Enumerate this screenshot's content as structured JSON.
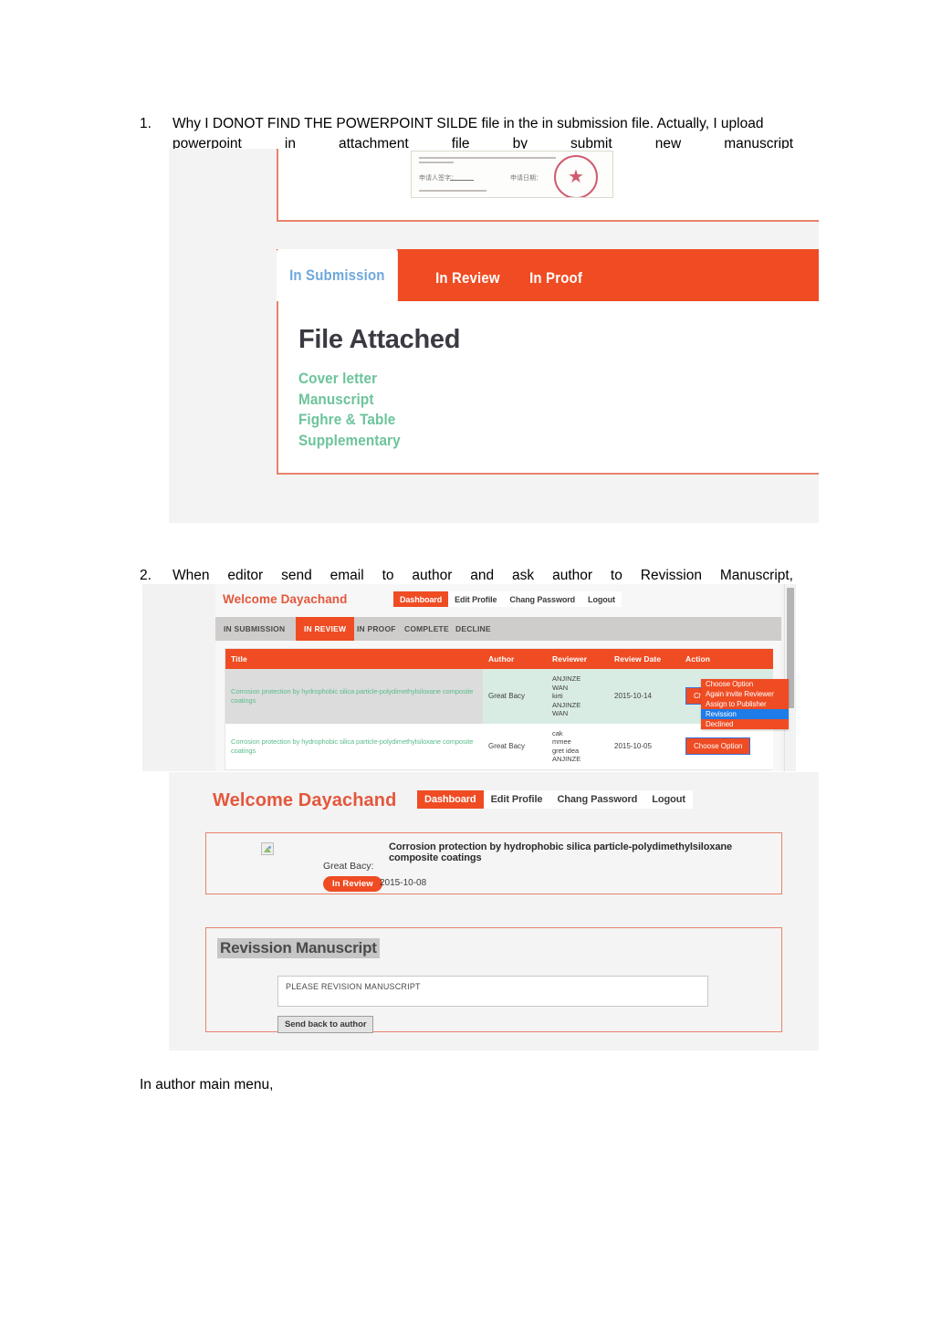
{
  "document": {
    "items": [
      {
        "number": "1.",
        "line1": "Why I DONOT FIND THE POWERPOINT SILDE  file in the in submission file. Actually, I upload",
        "line2": "powerpoint in attachment file by submit new manuscript"
      },
      {
        "number": "2.",
        "line1": "When editor send email to author and ask author to Revission Manuscript,"
      }
    ],
    "closing_text": "In author main menu,"
  },
  "shot1": {
    "scan": {
      "seal_icon": "red-official-seal-star",
      "sig_label": "申请人签字：",
      "date_label": "申请日期："
    },
    "tabs": [
      {
        "label": "In Submission",
        "active": true
      },
      {
        "label": "In Review",
        "active": false
      },
      {
        "label": "In Proof",
        "active": false
      }
    ],
    "heading": "File Attached",
    "links": [
      "Cover letter",
      "Manuscript",
      "Fighre & Table",
      "Supplementary"
    ],
    "colors": {
      "tab_bar": "#ef4c23",
      "active_tab_text": "#6ea8dc",
      "link_green": "#6cc49a",
      "panel_border": "#e8826a"
    }
  },
  "shot2": {
    "welcome": "Welcome Dayachand",
    "nav": [
      {
        "label": "Dashboard",
        "active": true
      },
      {
        "label": "Edit Profile",
        "active": false
      },
      {
        "label": "Chang Password",
        "active": false
      },
      {
        "label": "Logout",
        "active": false
      }
    ],
    "tabs": [
      {
        "label": "IN SUBMISSION",
        "active": false
      },
      {
        "label": "IN REVIEW",
        "active": true
      },
      {
        "label": "IN PROOF",
        "active": false
      },
      {
        "label": "COMPLETE",
        "active": false
      },
      {
        "label": "DECLINE",
        "active": false
      }
    ],
    "table": {
      "headers": [
        "Title",
        "Author",
        "Reviewer",
        "Review Date",
        "Action"
      ],
      "rows": [
        {
          "title": "Corrosion protection by hydrophobic silica particle-polydimethylsiloxane composite coatings",
          "author": "Great Bacy",
          "reviewers": "ANJINZE\nWAN\nkirti\nANJINZE\nWAN",
          "review_date": "2015-10-14",
          "action_label": "Choose Option"
        },
        {
          "title": "Corrosion protection by hydrophobic silica particle-polydimethylsiloxane composite coatings",
          "author": "Great Bacy",
          "reviewers": "cak\nmmee\ngret idea\nANJINZE",
          "review_date": "2015-10-05",
          "action_label": "Choose Option"
        }
      ]
    },
    "dropdown": {
      "open": true,
      "options": [
        {
          "label": "Choose Option",
          "selected": false
        },
        {
          "label": "Again invite Reviewer",
          "selected": false
        },
        {
          "label": "Assign to Publisher",
          "selected": false
        },
        {
          "label": "Revission",
          "selected": true
        },
        {
          "label": "Declined",
          "selected": false
        }
      ],
      "selected_highlight_color": "#1e7ce8"
    },
    "scrollbar": {
      "present": true
    }
  },
  "shot3": {
    "welcome": "Welcome Dayachand",
    "nav": [
      {
        "label": "Dashboard",
        "active": true
      },
      {
        "label": "Edit Profile",
        "active": false
      },
      {
        "label": "Chang Password",
        "active": false
      },
      {
        "label": "Logout",
        "active": false
      }
    ],
    "card": {
      "image_icon": "broken-image-icon",
      "title": "Corrosion protection by hydrophobic silica particle-polydimethylsiloxane composite coatings",
      "author": "Great Bacy:",
      "status_badge": "In Review",
      "date": "2015-10-08"
    },
    "revision_panel": {
      "heading": "Revission Manuscript",
      "textarea_value": "PLEASE REVISION MANUSCRIPT",
      "send_button": "Send back to author"
    },
    "colors": {
      "accent": "#ef4c23",
      "welcome_text": "#e4573c",
      "panel_border": "#e8826a"
    }
  }
}
